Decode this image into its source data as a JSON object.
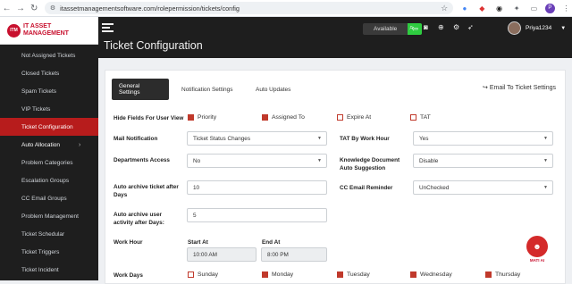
{
  "browser": {
    "url": "itassetmanagementsoftware.com/rolepermission/tickets/config",
    "profile_initial": "P"
  },
  "logo": {
    "mark": "ITM",
    "line1": "IT ASSET",
    "line2": "MANAGEMENT"
  },
  "sidebar": {
    "items": [
      {
        "label": "Not Assigned Tickets"
      },
      {
        "label": "Closed Tickets"
      },
      {
        "label": "Spam Tickets"
      },
      {
        "label": "VIP Tickets"
      },
      {
        "label": "Ticket Configuration"
      },
      {
        "label": "Auto Allocation"
      },
      {
        "label": "Problem Categories"
      },
      {
        "label": "Escalation Groups"
      },
      {
        "label": "CC Email Groups"
      },
      {
        "label": "Problem Management"
      },
      {
        "label": "Ticket Schedular"
      },
      {
        "label": "Ticket Triggers"
      },
      {
        "label": "Ticket Incident"
      }
    ]
  },
  "topbar": {
    "status": "Available",
    "user_name": "Priya1234"
  },
  "page": {
    "title": "Ticket Configuration"
  },
  "tabs": [
    {
      "label": "General Settings"
    },
    {
      "label": "Notification Settings"
    },
    {
      "label": "Auto Updates"
    }
  ],
  "email_link": "Email To Ticket Settings",
  "form": {
    "hide_fields_label": "Hide Fields For User View",
    "hide_fields": [
      {
        "label": "Priority",
        "checked": true
      },
      {
        "label": "Assigned To",
        "checked": true
      },
      {
        "label": "Expire At",
        "checked": false
      },
      {
        "label": "TAT",
        "checked": false
      }
    ],
    "mail_notification_label": "Mail Notification",
    "mail_notification_value": "Ticket Status Changes",
    "tat_label": "TAT By Work Hour",
    "tat_value": "Yes",
    "departments_label": "Departments Access",
    "departments_value": "No",
    "kb_label_1": "Knowledge Document",
    "kb_label_2": "Auto Suggestion",
    "kb_value": "Disable",
    "archive_ticket_label_1": "Auto archive ticket after",
    "archive_ticket_label_2": "Days",
    "archive_ticket_value": "10",
    "cc_label": "CC Email Reminder",
    "cc_value": "UnChecked",
    "archive_user_label_1": "Auto archive user",
    "archive_user_label_2": "activity after Days:",
    "archive_user_value": "5",
    "work_hour_label": "Work Hour",
    "start_label": "Start At",
    "start_value": "10:00 AM",
    "end_label": "End At",
    "end_value": "8:00 PM",
    "work_days_label": "Work Days",
    "work_days": [
      {
        "label": "Sunday",
        "checked": false
      },
      {
        "label": "Monday",
        "checked": true
      },
      {
        "label": "Tuesday",
        "checked": true
      },
      {
        "label": "Wednesday",
        "checked": true
      },
      {
        "label": "Thursday",
        "checked": true
      }
    ]
  },
  "assistant": {
    "label": "MATI AI"
  }
}
